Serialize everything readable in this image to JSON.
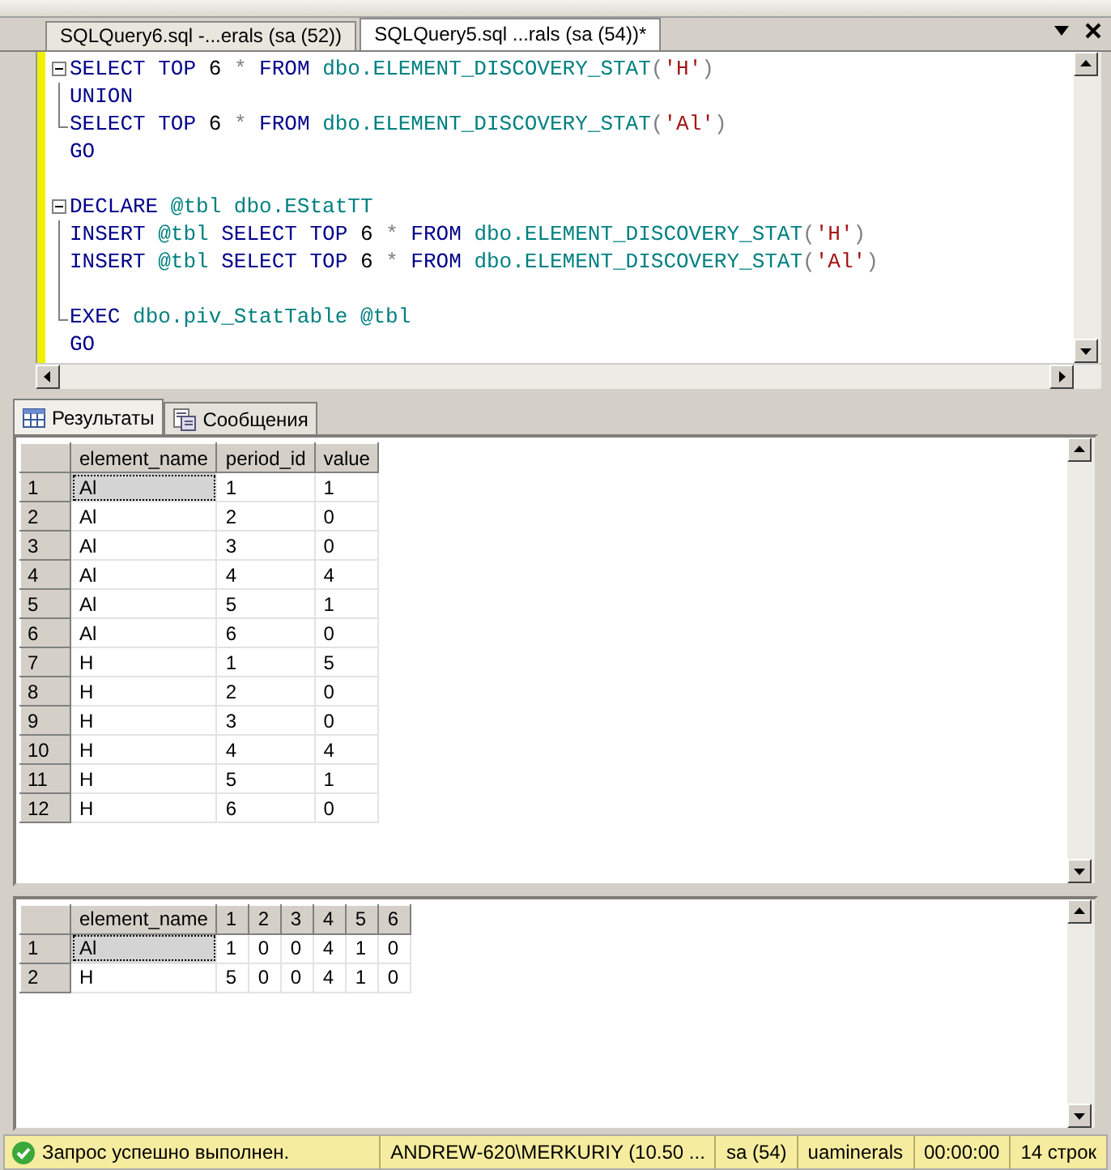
{
  "doc_tabs": [
    {
      "label": "SQLQuery6.sql -...erals (sa (52))",
      "selected": false
    },
    {
      "label": "SQLQuery5.sql ...rals (sa (54))*",
      "selected": true
    }
  ],
  "code_lines": [
    {
      "kind": "start",
      "tokens": [
        {
          "kind": "kw",
          "text": "SELECT TOP "
        },
        {
          "kind": "plain",
          "text": "6 "
        },
        {
          "kind": "op",
          "text": "* "
        },
        {
          "kind": "kw",
          "text": "FROM "
        },
        {
          "kind": "obj",
          "text": "dbo.ELEMENT_DISCOVERY_STAT"
        },
        {
          "kind": "op",
          "text": "("
        },
        {
          "kind": "str",
          "text": "'H'"
        },
        {
          "kind": "op",
          "text": ")"
        }
      ]
    },
    {
      "kind": "mid",
      "tokens": [
        {
          "kind": "kw",
          "text": "UNION"
        }
      ]
    },
    {
      "kind": "end",
      "tokens": [
        {
          "kind": "kw",
          "text": "SELECT TOP "
        },
        {
          "kind": "plain",
          "text": "6 "
        },
        {
          "kind": "op",
          "text": "* "
        },
        {
          "kind": "kw",
          "text": "FROM "
        },
        {
          "kind": "obj",
          "text": "dbo.ELEMENT_DISCOVERY_STAT"
        },
        {
          "kind": "op",
          "text": "("
        },
        {
          "kind": "str",
          "text": "'Al'"
        },
        {
          "kind": "op",
          "text": ")"
        }
      ]
    },
    {
      "kind": "none",
      "tokens": [
        {
          "kind": "kw",
          "text": "GO"
        }
      ]
    },
    {
      "kind": "none"
    },
    {
      "kind": "start",
      "tokens": [
        {
          "kind": "kw",
          "text": "DECLARE "
        },
        {
          "kind": "obj",
          "text": "@tbl dbo.EStatTT"
        }
      ]
    },
    {
      "kind": "mid",
      "tokens": [
        {
          "kind": "kw",
          "text": "INSERT "
        },
        {
          "kind": "obj",
          "text": "@tbl "
        },
        {
          "kind": "kw",
          "text": "SELECT TOP "
        },
        {
          "kind": "plain",
          "text": "6 "
        },
        {
          "kind": "op",
          "text": "* "
        },
        {
          "kind": "kw",
          "text": "FROM "
        },
        {
          "kind": "obj",
          "text": "dbo.ELEMENT_DISCOVERY_STAT"
        },
        {
          "kind": "op",
          "text": "("
        },
        {
          "kind": "str",
          "text": "'H'"
        },
        {
          "kind": "op",
          "text": ")"
        }
      ]
    },
    {
      "kind": "mid",
      "tokens": [
        {
          "kind": "kw",
          "text": "INSERT "
        },
        {
          "kind": "obj",
          "text": "@tbl "
        },
        {
          "kind": "kw",
          "text": "SELECT TOP "
        },
        {
          "kind": "plain",
          "text": "6 "
        },
        {
          "kind": "op",
          "text": "* "
        },
        {
          "kind": "kw",
          "text": "FROM "
        },
        {
          "kind": "obj",
          "text": "dbo.ELEMENT_DISCOVERY_STAT"
        },
        {
          "kind": "op",
          "text": "("
        },
        {
          "kind": "str",
          "text": "'Al'"
        },
        {
          "kind": "op",
          "text": ")"
        }
      ]
    },
    {
      "kind": "mid"
    },
    {
      "kind": "end",
      "tokens": [
        {
          "kind": "kw",
          "text": "EXEC "
        },
        {
          "kind": "obj",
          "text": "dbo.piv_StatTable @tbl"
        }
      ]
    },
    {
      "kind": "none",
      "tokens": [
        {
          "kind": "kw",
          "text": "GO"
        }
      ]
    }
  ],
  "result_tabs": [
    {
      "label": "Результаты",
      "selected": true
    },
    {
      "label": "Сообщения",
      "selected": false
    }
  ],
  "grids": [
    {
      "columns": [
        "element_name",
        "period_id",
        "value"
      ],
      "rows": [
        {
          "num": "1",
          "cells": [
            "Al",
            "1",
            "1"
          ]
        },
        {
          "num": "2",
          "cells": [
            "Al",
            "2",
            "0"
          ]
        },
        {
          "num": "3",
          "cells": [
            "Al",
            "3",
            "0"
          ]
        },
        {
          "num": "4",
          "cells": [
            "Al",
            "4",
            "4"
          ]
        },
        {
          "num": "5",
          "cells": [
            "Al",
            "5",
            "1"
          ]
        },
        {
          "num": "6",
          "cells": [
            "Al",
            "6",
            "0"
          ]
        },
        {
          "num": "7",
          "cells": [
            "H",
            "1",
            "5"
          ]
        },
        {
          "num": "8",
          "cells": [
            "H",
            "2",
            "0"
          ]
        },
        {
          "num": "9",
          "cells": [
            "H",
            "3",
            "0"
          ]
        },
        {
          "num": "10",
          "cells": [
            "H",
            "4",
            "4"
          ]
        },
        {
          "num": "11",
          "cells": [
            "H",
            "5",
            "1"
          ]
        },
        {
          "num": "12",
          "cells": [
            "H",
            "6",
            "0"
          ]
        }
      ]
    },
    {
      "columns": [
        "element_name",
        "1",
        "2",
        "3",
        "4",
        "5",
        "6"
      ],
      "rows": [
        {
          "num": "1",
          "cells": [
            "Al",
            "1",
            "0",
            "0",
            "4",
            "1",
            "0"
          ]
        },
        {
          "num": "2",
          "cells": [
            "H",
            "5",
            "0",
            "0",
            "4",
            "1",
            "0"
          ]
        }
      ]
    }
  ],
  "status_bar": {
    "message": "Запрос успешно выполнен.",
    "fields": [
      "ANDREW-620\\MERKURIY (10.50 ...",
      "sa (54)",
      "uaminerals",
      "00:00:00",
      "14 строк"
    ]
  }
}
